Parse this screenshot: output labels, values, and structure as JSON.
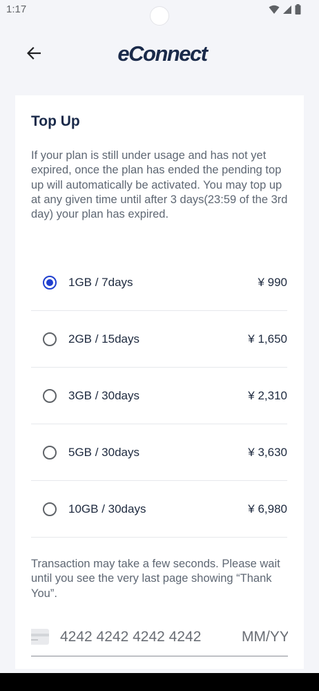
{
  "status_bar": {
    "time": "1:17"
  },
  "app_bar": {
    "logo_text": "eConnect"
  },
  "card": {
    "title": "Top Up",
    "description": "If your plan is still under usage and has not yet expired, once the plan has ended the pending top up will automatically be activated. You may top up at any given time until after 3 days(23:59 of the 3rd day) your plan has expired.",
    "plans": [
      {
        "label": "1GB / 7days",
        "price": "¥ 990",
        "selected": true
      },
      {
        "label": "2GB / 15days",
        "price": "¥ 1,650",
        "selected": false
      },
      {
        "label": "3GB / 30days",
        "price": "¥ 2,310",
        "selected": false
      },
      {
        "label": "5GB / 30days",
        "price": "¥ 3,630",
        "selected": false
      },
      {
        "label": "10GB / 30days",
        "price": "¥ 6,980",
        "selected": false
      }
    ],
    "notice": "Transaction may take a few seconds. Please wait until you see the very last page showing “Thank You”.",
    "payment": {
      "card_number_placeholder": "4242 4242 4242 4242",
      "expiry_placeholder": "MM/YY"
    }
  },
  "colors": {
    "brand": "#1a2a4a",
    "accent": "#1f3fcf",
    "background": "#f4f5f9"
  }
}
